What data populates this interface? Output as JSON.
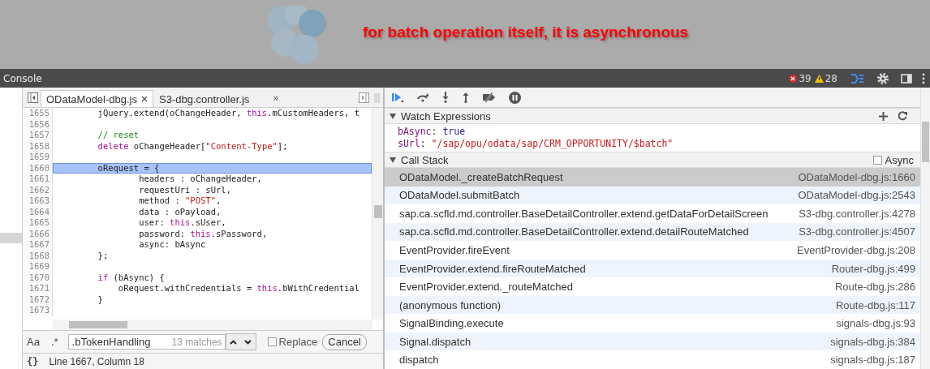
{
  "annotation": {
    "text": "for batch operation itself, it is asynchronous"
  },
  "console_bar": {
    "title": "Console",
    "error_count": "39",
    "warning_count": "28"
  },
  "editor": {
    "tabs": [
      {
        "label": "ODataModel-dbg.js",
        "selected": true
      },
      {
        "label": "S3-dbg.controller.js",
        "selected": false
      }
    ],
    "overflow": "»",
    "lines": [
      {
        "number": "1655",
        "selected": false,
        "segments": [
          {
            "kind": "plain",
            "text": "        jQuery.extend(oChangeHeader, "
          },
          {
            "kind": "keyword",
            "text": "this"
          },
          {
            "kind": "plain",
            "text": ".mCustomHeaders, t"
          }
        ]
      },
      {
        "number": "1656",
        "selected": false
      },
      {
        "number": "1657",
        "selected": false,
        "segments": [
          {
            "kind": "comment",
            "text": "        // reset"
          }
        ]
      },
      {
        "number": "1658",
        "selected": false,
        "segments": [
          {
            "kind": "keyword",
            "text": "        delete"
          },
          {
            "kind": "plain",
            "text": " oChangeHeader["
          },
          {
            "kind": "string",
            "text": "\"Content-Type\""
          },
          {
            "kind": "plain",
            "text": "];"
          }
        ]
      },
      {
        "number": "1659",
        "selected": false
      },
      {
        "number": "1660",
        "selected": true,
        "segments": [
          {
            "kind": "plain",
            "text": "        oRequest = {"
          }
        ]
      },
      {
        "number": "1661",
        "selected": false,
        "segments": [
          {
            "kind": "plain",
            "text": "                headers : oChangeHeader,"
          }
        ]
      },
      {
        "number": "1662",
        "selected": false,
        "segments": [
          {
            "kind": "plain",
            "text": "                requestUri : sUrl,"
          }
        ]
      },
      {
        "number": "1663",
        "selected": false,
        "segments": [
          {
            "kind": "plain",
            "text": "                method : "
          },
          {
            "kind": "string",
            "text": "\"POST\""
          },
          {
            "kind": "plain",
            "text": ","
          }
        ]
      },
      {
        "number": "1664",
        "selected": false,
        "segments": [
          {
            "kind": "plain",
            "text": "                data : oPayload,"
          }
        ]
      },
      {
        "number": "1665",
        "selected": false,
        "segments": [
          {
            "kind": "plain",
            "text": "                user: "
          },
          {
            "kind": "keyword",
            "text": "this"
          },
          {
            "kind": "plain",
            "text": ".sUser,"
          }
        ]
      },
      {
        "number": "1666",
        "selected": false,
        "segments": [
          {
            "kind": "plain",
            "text": "                password: "
          },
          {
            "kind": "keyword",
            "text": "this"
          },
          {
            "kind": "plain",
            "text": ".sPassword,"
          }
        ]
      },
      {
        "number": "1667",
        "selected": false,
        "segments": [
          {
            "kind": "plain",
            "text": "                async: bAsync"
          }
        ]
      },
      {
        "number": "1668",
        "selected": false,
        "segments": [
          {
            "kind": "plain",
            "text": "        };"
          }
        ]
      },
      {
        "number": "1669",
        "selected": false
      },
      {
        "number": "1670",
        "selected": false,
        "segments": [
          {
            "kind": "keyword",
            "text": "        if"
          },
          {
            "kind": "plain",
            "text": " (bAsync) {"
          }
        ]
      },
      {
        "number": "1671",
        "selected": false,
        "segments": [
          {
            "kind": "plain",
            "text": "            oRequest.withCredentials = "
          },
          {
            "kind": "keyword",
            "text": "this"
          },
          {
            "kind": "plain",
            "text": ".bWithCredential"
          }
        ]
      },
      {
        "number": "1672",
        "selected": false,
        "segments": [
          {
            "kind": "plain",
            "text": "        }"
          }
        ]
      },
      {
        "number": "1673",
        "selected": false
      }
    ],
    "search": {
      "case_toggle": "Aa",
      "regex_toggle": ".*",
      "value": ".bTokenHandling",
      "match_count": "13 matches",
      "replace": {
        "label": "Replace",
        "checked": false
      },
      "cancel": "Cancel"
    },
    "status": {
      "format_toggle": "{}",
      "position": "Line 1667, Column 18"
    }
  },
  "debugger": {
    "watch": {
      "title": "Watch Expressions",
      "expanded": true,
      "items": [
        {
          "name": "bAsync",
          "separator": ":",
          "value": "true",
          "kind": "boolean"
        },
        {
          "name": "sUrl",
          "separator": ":",
          "value": "\"/sap/opu/odata/sap/CRM_OPPORTUNITY/$batch\"",
          "kind": "string"
        }
      ]
    },
    "call_stack": {
      "title": "Call Stack",
      "expanded": true,
      "async": {
        "label": "Async",
        "checked": false
      },
      "frames": [
        {
          "function": "ODataModel._createBatchRequest",
          "location": "ODataModel-dbg.js:1660",
          "selected": true
        },
        {
          "function": "ODataModel.submitBatch",
          "location": "ODataModel-dbg.js:2543",
          "selected": false
        },
        {
          "function": "sap.ca.scfld.md.controller.BaseDetailController.extend.getDataForDetailScreen",
          "location": "S3-dbg.controller.js:4278",
          "selected": false
        },
        {
          "function": "sap.ca.scfld.md.controller.BaseDetailController.extend.detailRouteMatched",
          "location": "S3-dbg.controller.js:4507",
          "selected": false
        },
        {
          "function": "EventProvider.fireEvent",
          "location": "EventProvider-dbg.js:208",
          "selected": false
        },
        {
          "function": "EventProvider.extend.fireRouteMatched",
          "location": "Router-dbg.js:499",
          "selected": false
        },
        {
          "function": "EventProvider.extend._routeMatched",
          "location": "Route-dbg.js:286",
          "selected": false
        },
        {
          "function": "(anonymous function)",
          "location": "Route-dbg.js:117",
          "selected": false
        },
        {
          "function": "SignalBinding.execute",
          "location": "signals-dbg.js:93",
          "selected": false
        },
        {
          "function": "Signal.dispatch",
          "location": "signals-dbg.js:384",
          "selected": false
        },
        {
          "function": "dispatch",
          "location": "signals-dbg.js:187",
          "selected": false
        }
      ]
    }
  }
}
